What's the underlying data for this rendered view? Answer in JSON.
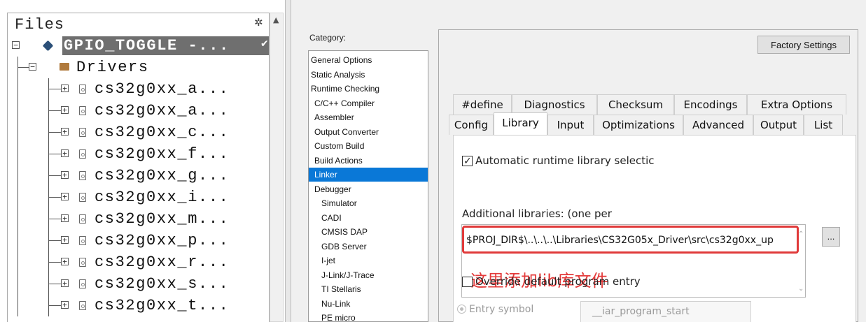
{
  "files_panel": {
    "title": "Files",
    "gear_icon": "gear-icon",
    "tree": [
      {
        "level": 0,
        "kind": "project",
        "expander": "−",
        "label": "GPIO_TOGGLE -...",
        "selected": true,
        "checked": true
      },
      {
        "level": 1,
        "kind": "folder",
        "expander": "−",
        "label": "Drivers"
      },
      {
        "level": 2,
        "kind": "file",
        "expander": "+",
        "label": "cs32g0xx_a..."
      },
      {
        "level": 2,
        "kind": "file",
        "expander": "+",
        "label": "cs32g0xx_a..."
      },
      {
        "level": 2,
        "kind": "file",
        "expander": "+",
        "label": "cs32g0xx_c..."
      },
      {
        "level": 2,
        "kind": "file",
        "expander": "+",
        "label": "cs32g0xx_f..."
      },
      {
        "level": 2,
        "kind": "file",
        "expander": "+",
        "label": "cs32g0xx_g..."
      },
      {
        "level": 2,
        "kind": "file",
        "expander": "+",
        "label": "cs32g0xx_i..."
      },
      {
        "level": 2,
        "kind": "file",
        "expander": "+",
        "label": "cs32g0xx_m..."
      },
      {
        "level": 2,
        "kind": "file",
        "expander": "+",
        "label": "cs32g0xx_p..."
      },
      {
        "level": 2,
        "kind": "file",
        "expander": "+",
        "label": "cs32g0xx_r..."
      },
      {
        "level": 2,
        "kind": "file",
        "expander": "+",
        "label": "cs32g0xx_s..."
      },
      {
        "level": 2,
        "kind": "file",
        "expander": "+",
        "label": "cs32g0xx_t..."
      }
    ]
  },
  "options": {
    "category_label": "Category:",
    "categories": [
      {
        "label": "General Options",
        "indent": false
      },
      {
        "label": "Static Analysis",
        "indent": false
      },
      {
        "label": "Runtime Checking",
        "indent": false
      },
      {
        "label": "C/C++ Compiler",
        "indent": true
      },
      {
        "label": "Assembler",
        "indent": true
      },
      {
        "label": "Output Converter",
        "indent": true
      },
      {
        "label": "Custom Build",
        "indent": true
      },
      {
        "label": "Build Actions",
        "indent": true
      },
      {
        "label": "Linker",
        "indent": true,
        "selected": true
      },
      {
        "label": "Debugger",
        "indent": true
      },
      {
        "label": "Simulator",
        "indent": 2
      },
      {
        "label": "CADI",
        "indent": 2
      },
      {
        "label": "CMSIS DAP",
        "indent": 2
      },
      {
        "label": "GDB Server",
        "indent": 2
      },
      {
        "label": "I-jet",
        "indent": 2
      },
      {
        "label": "J-Link/J-Trace",
        "indent": 2
      },
      {
        "label": "TI Stellaris",
        "indent": 2
      },
      {
        "label": "Nu-Link",
        "indent": 2
      },
      {
        "label": "PE micro",
        "indent": 2
      }
    ],
    "factory_settings_label": "Factory Settings",
    "tabs_row1": [
      "#define",
      "Diagnostics",
      "Checksum",
      "Encodings",
      "Extra Options"
    ],
    "tabs_row2": [
      "Config",
      "Library",
      "Input",
      "Optimizations",
      "Advanced",
      "Output",
      "List"
    ],
    "active_tab": "Library",
    "auto_runtime_label": "Automatic runtime library selectic",
    "auto_runtime_checked": true,
    "additional_libraries_label": "Additional libraries: (one per",
    "library_path": "$PROJ_DIR$\\..\\..\\..\\Libraries\\CS32G05x_Driver\\src\\cs32g0xx_up",
    "annotation": "这里添加lib库文件",
    "annotation_color": "#e33a3a",
    "browse_label": "...",
    "override_entry_label": "Override default program entry",
    "override_entry_checked": false,
    "entry_symbol_label": "Entry symbol",
    "entry_symbol_value": "__iar_program_start"
  },
  "colors": {
    "selection_blue": "#0a78d7",
    "tree_selection_gray": "#6f6f6f"
  }
}
